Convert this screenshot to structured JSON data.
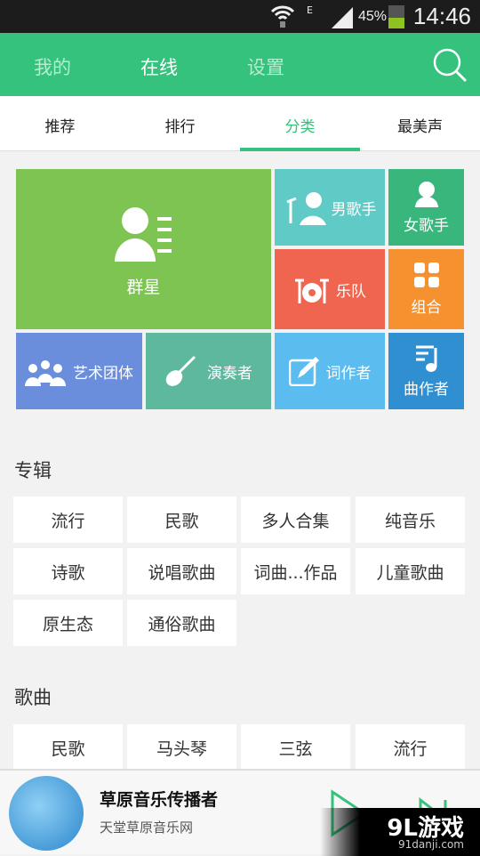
{
  "status": {
    "battery": "45%",
    "battery_level": 45,
    "time": "14:46",
    "network": "E"
  },
  "header": {
    "tabs": [
      "我的",
      "在线",
      "设置"
    ],
    "active": "在线"
  },
  "subtabs": {
    "items": [
      "推荐",
      "排行",
      "分类",
      "最美声"
    ],
    "active": "分类"
  },
  "tiles": [
    {
      "label": "群星",
      "color": "#7dc452",
      "icon": "people-list-icon"
    },
    {
      "label": "男歌手",
      "color": "#5fcac6",
      "icon": "male-singer-icon"
    },
    {
      "label": "女歌手",
      "color": "#38b67c",
      "icon": "female-singer-icon"
    },
    {
      "label": "乐队",
      "color": "#f0654f",
      "icon": "drum-kit-icon"
    },
    {
      "label": "组合",
      "color": "#f5922f",
      "icon": "grid-icon"
    },
    {
      "label": "艺术团体",
      "color": "#6b8edc",
      "icon": "group-icon"
    },
    {
      "label": "演奏者",
      "color": "#5db89e",
      "icon": "guitar-icon"
    },
    {
      "label": "词作者",
      "color": "#5bbcf0",
      "icon": "pen-icon"
    },
    {
      "label": "曲作者",
      "color": "#2f8fd1",
      "icon": "music-note-icon"
    }
  ],
  "albums": {
    "title": "专辑",
    "items": [
      "流行",
      "民歌",
      "多人合集",
      "纯音乐",
      "诗歌",
      "说唱歌曲",
      "词曲...作品",
      "儿童歌曲",
      "原生态",
      "通俗歌曲"
    ]
  },
  "songs": {
    "title": "歌曲",
    "items": [
      "民歌",
      "马头琴",
      "三弦",
      "流行"
    ]
  },
  "player": {
    "title": "草原音乐传播者",
    "subtitle": "天堂草原音乐网"
  },
  "watermark": {
    "logo": "9L游戏",
    "site": "91danji.com"
  }
}
